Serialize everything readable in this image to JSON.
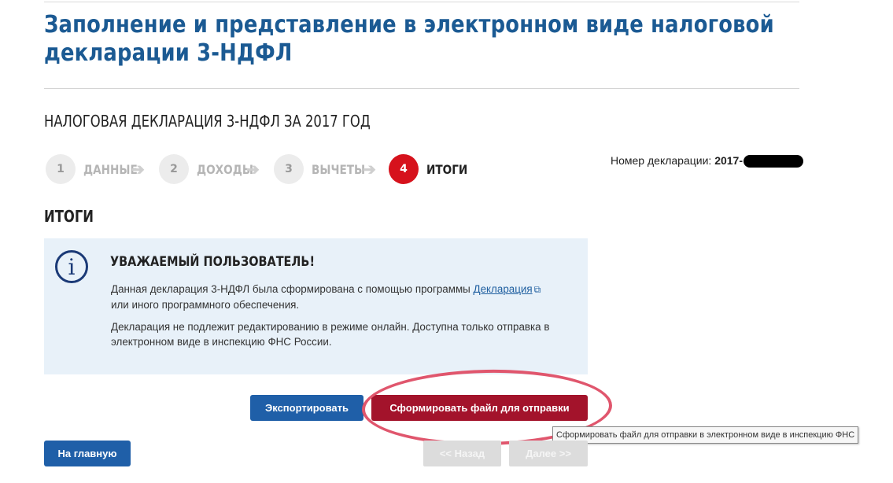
{
  "page": {
    "title": "Заполнение и представление в электронном виде налоговой декларации 3-НДФЛ",
    "declaration_heading": "НАЛОГОВАЯ ДЕКЛАРАЦИЯ 3-НДФЛ ЗА 2017 ГОД",
    "declaration_number_label": "Номер декларации:",
    "declaration_number_value": "2017-",
    "section_title": "ИТОГИ"
  },
  "steps": [
    {
      "num": "1",
      "label": "ДАННЫЕ",
      "active": false
    },
    {
      "num": "2",
      "label": "ДОХОДЫ",
      "active": false
    },
    {
      "num": "3",
      "label": "ВЫЧЕТЫ",
      "active": false
    },
    {
      "num": "4",
      "label": "ИТОГИ",
      "active": true
    }
  ],
  "info": {
    "icon": "info-icon",
    "title": "УВАЖАЕМЫЙ ПОЛЬЗОВАТЕЛЬ!",
    "p1_before": "Данная декларация 3-НДФЛ была сформирована с помощью программы",
    "p1_link": "Декларация",
    "p1_after": "или иного программного обеспечения.",
    "p2": "Декларация не подлежит редактированию в режиме онлайн. Доступна только отправка в электронном виде в инспекцию ФНС России."
  },
  "buttons": {
    "export": "Экспортировать",
    "form_file": "Сформировать файл для отправки",
    "home": "На главную",
    "back": "<< Назад",
    "next": "Далее >>"
  },
  "tooltip": "Сформировать файл для отправки в электронном виде в инспекцию ФНС",
  "colors": {
    "title_blue": "#1b5a93",
    "primary_button": "#1f5fa8",
    "submit_button": "#a3132b",
    "active_step": "#d6121c",
    "info_bg": "#e8f1f9",
    "annotation_oval": "#e0566d"
  }
}
